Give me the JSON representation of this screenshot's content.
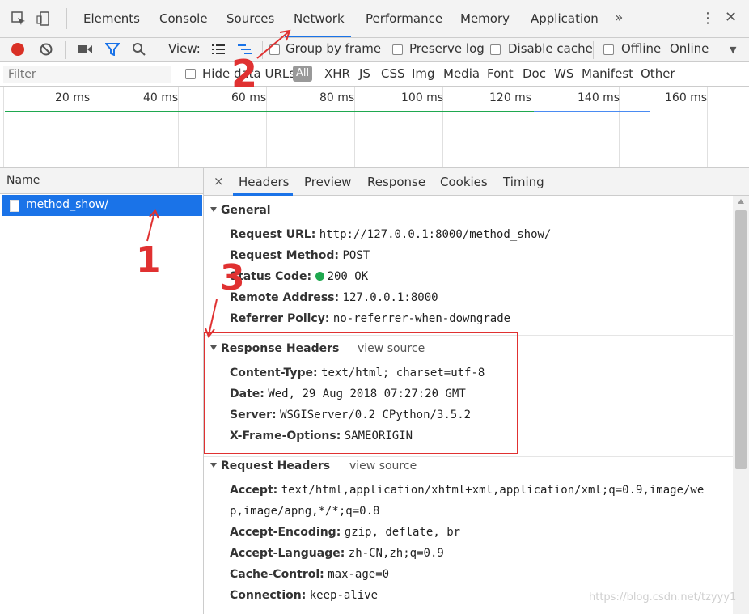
{
  "devtools": {
    "tabs": [
      "Elements",
      "Console",
      "Sources",
      "Network",
      "Performance",
      "Memory",
      "Application"
    ],
    "active_tab": "Network",
    "more_label": "»",
    "kebab_label": "⋮",
    "close_label": "✕"
  },
  "toolbar": {
    "view_label": "View:",
    "group_by_frame": "Group by frame",
    "preserve_log": "Preserve log",
    "disable_cache": "Disable cache",
    "offline": "Offline",
    "online": "Online",
    "dropdown": "▼"
  },
  "filterbar": {
    "placeholder": "Filter",
    "hide_data_urls": "Hide data URLs",
    "all": "All",
    "types": [
      "XHR",
      "JS",
      "CSS",
      "Img",
      "Media",
      "Font",
      "Doc",
      "WS",
      "Manifest",
      "Other"
    ]
  },
  "timeline": {
    "ticks": [
      "20 ms",
      "40 ms",
      "60 ms",
      "80 ms",
      "100 ms",
      "120 ms",
      "140 ms",
      "160 ms"
    ]
  },
  "requests": {
    "header": "Name",
    "items": [
      {
        "name": "method_show/"
      }
    ]
  },
  "details": {
    "close": "×",
    "tabs": [
      "Headers",
      "Preview",
      "Response",
      "Cookies",
      "Timing"
    ],
    "active_tab": "Headers",
    "general": {
      "title": "General",
      "rows": [
        {
          "key": "Request URL:",
          "value": "http://127.0.0.1:8000/method_show/"
        },
        {
          "key": "Request Method:",
          "value": "POST"
        },
        {
          "key": "Status Code:",
          "value": "200 OK"
        },
        {
          "key": "Remote Address:",
          "value": "127.0.0.1:8000"
        },
        {
          "key": "Referrer Policy:",
          "value": "no-referrer-when-downgrade"
        }
      ]
    },
    "response_headers": {
      "title": "Response Headers",
      "view_source": "view source",
      "rows": [
        {
          "key": "Content-Type:",
          "value": "text/html; charset=utf-8"
        },
        {
          "key": "Date:",
          "value": "Wed, 29 Aug 2018 07:27:20 GMT"
        },
        {
          "key": "Server:",
          "value": "WSGIServer/0.2 CPython/3.5.2"
        },
        {
          "key": "X-Frame-Options:",
          "value": "SAMEORIGIN"
        }
      ]
    },
    "request_headers": {
      "title": "Request Headers",
      "view_source": "view source",
      "rows": [
        {
          "key": "Accept:",
          "value": "text/html,application/xhtml+xml,application/xml;q=0.9,image/we"
        },
        {
          "key": "",
          "value": "p,image/apng,*/*;q=0.8"
        },
        {
          "key": "Accept-Encoding:",
          "value": "gzip, deflate, br"
        },
        {
          "key": "Accept-Language:",
          "value": "zh-CN,zh;q=0.9"
        },
        {
          "key": "Cache-Control:",
          "value": "max-age=0"
        },
        {
          "key": "Connection:",
          "value": "keep-alive"
        }
      ]
    }
  },
  "annotations": {
    "label_1": "1",
    "label_2": "2",
    "label_3": "3"
  },
  "watermark": "https://blog.csdn.net/tzyyy1",
  "colors": {
    "accent": "#1a73e8",
    "annotation": "#e03131",
    "status_ok": "#1fa84f"
  }
}
